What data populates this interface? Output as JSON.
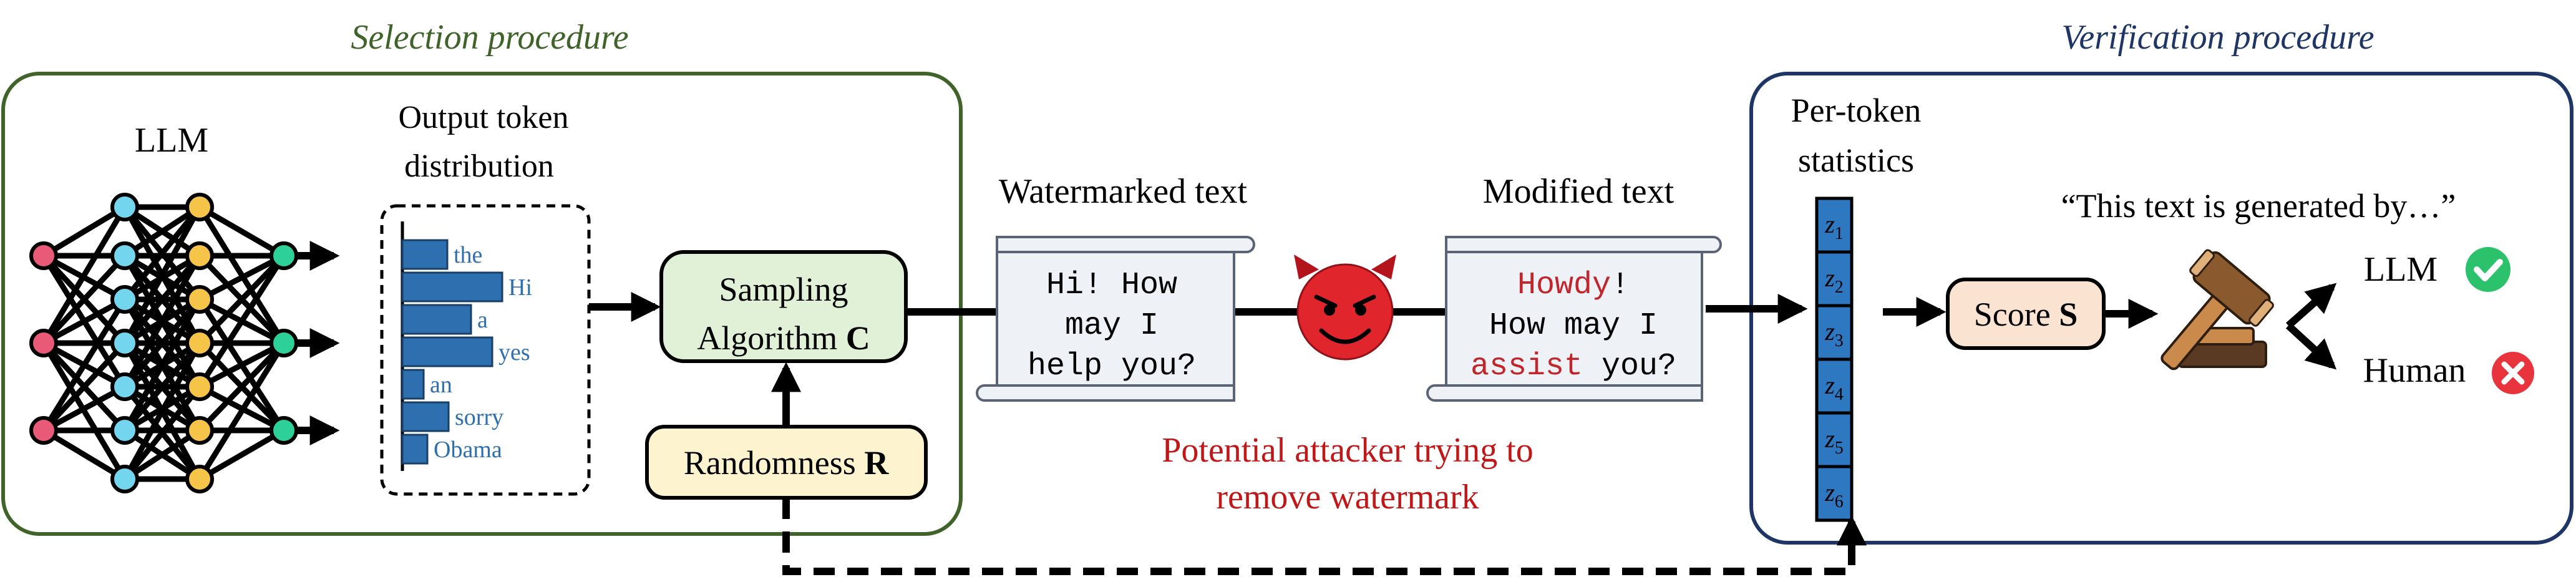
{
  "selection": {
    "title": "Selection procedure",
    "llm_label": "LLM",
    "dist_label_1": "Output token",
    "dist_label_2": "distribution",
    "tokens": [
      "the",
      "Hi",
      "a",
      "yes",
      "an",
      "sorry",
      "Obama"
    ],
    "token_probs": [
      0.36,
      0.8,
      0.55,
      0.72,
      0.17,
      0.37,
      0.2
    ],
    "sampling_1": "Sampling",
    "sampling_2": "Algorithm",
    "sampling_var": "C",
    "randomness": "Randomness",
    "randomness_var": "R"
  },
  "text": {
    "watermarked_title": "Watermarked text",
    "watermarked_lines": [
      "Hi! How",
      "may I",
      "help you?"
    ],
    "modified_title": "Modified text",
    "modified_line1_red": "Howdy",
    "modified_line1_rest": "!",
    "modified_line2": "How may I",
    "modified_line3_red": "assist",
    "modified_line3_rest": " you?",
    "attacker_1": "Potential attacker trying to",
    "attacker_2": "remove watermark"
  },
  "verification": {
    "title": "Verification procedure",
    "stats_1": "Per-token",
    "stats_2": "statistics",
    "z_labels": [
      "1",
      "2",
      "3",
      "4",
      "5",
      "6"
    ],
    "score": "Score",
    "score_var": "S",
    "quote": "“This text is generated by…”",
    "llm": "LLM",
    "human": "Human"
  },
  "colors": {
    "selection_border": "#3f6328",
    "verification_border": "#1f3566",
    "bar_fill": "#2e6fb0",
    "token_text": "#2e6fb0",
    "sampling_fill": "#e0f1d8",
    "randomness_fill": "#fdf3cf",
    "score_fill": "#fbe3d2",
    "attacker_text": "#c01818",
    "red_token": "#c0262c",
    "check_green": "#2cc16b",
    "cross_red": "#e8343c"
  },
  "icons": [
    "neural-network-icon",
    "devil-icon",
    "gavel-icon",
    "check-icon",
    "cross-icon",
    "scroll-icon"
  ]
}
